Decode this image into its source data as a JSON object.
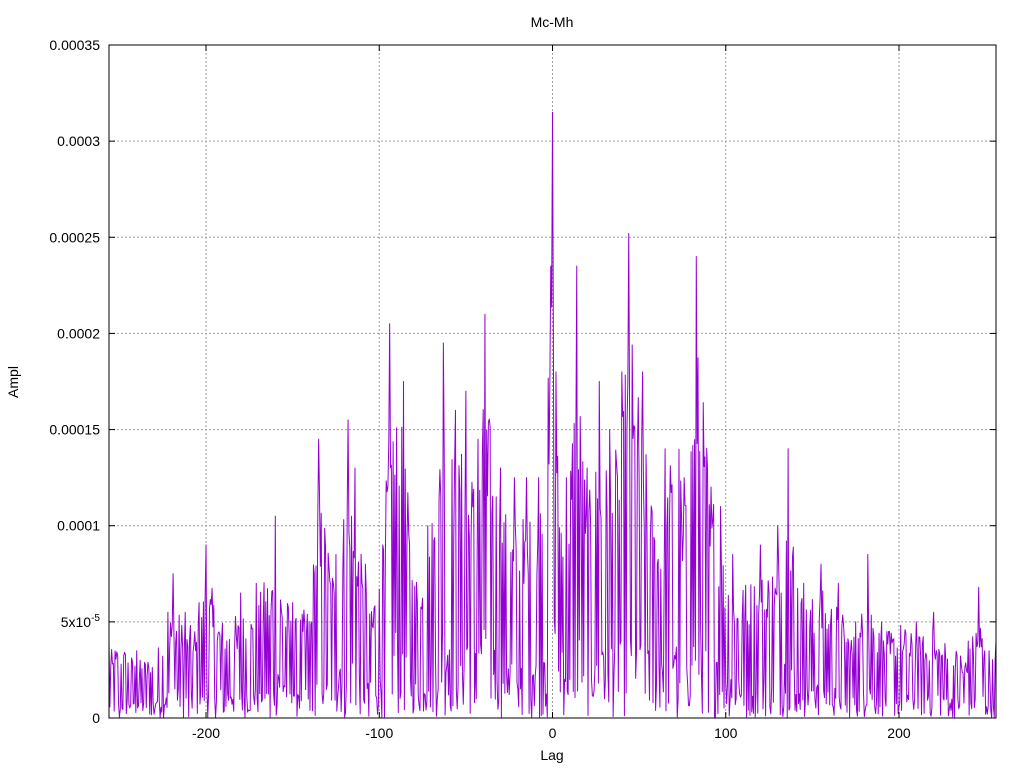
{
  "chart_data": {
    "type": "line",
    "title": "Mc-Mh",
    "xlabel": "Lag",
    "ylabel": "Ampl",
    "xlim": [
      -256,
      256
    ],
    "ylim": [
      0,
      0.00035
    ],
    "grid": true,
    "line_color": "#9400d3",
    "x_ticks": [
      {
        "value": -200,
        "label": "-200"
      },
      {
        "value": -100,
        "label": "-100"
      },
      {
        "value": 0,
        "label": "0"
      },
      {
        "value": 100,
        "label": "100"
      },
      {
        "value": 200,
        "label": "200"
      }
    ],
    "y_ticks": [
      {
        "value": 0,
        "label": "0"
      },
      {
        "value": 5e-05,
        "label": "5x10",
        "sup": "-5"
      },
      {
        "value": 0.0001,
        "label": "0.0001"
      },
      {
        "value": 0.00015,
        "label": "0.00015"
      },
      {
        "value": 0.0002,
        "label": "0.0002"
      },
      {
        "value": 0.00025,
        "label": "0.00025"
      },
      {
        "value": 0.0003,
        "label": "0.0003"
      },
      {
        "value": 0.00035,
        "label": "0.00035"
      }
    ],
    "peaks": [
      {
        "x": -256,
        "y": 4e-05
      },
      {
        "x": -250,
        "y": 4.8e-05
      },
      {
        "x": -240,
        "y": 3.5e-05
      },
      {
        "x": -230,
        "y": 4e-05
      },
      {
        "x": -222,
        "y": 5.5e-05
      },
      {
        "x": -219,
        "y": 7.5e-05
      },
      {
        "x": -212,
        "y": 5.5e-05
      },
      {
        "x": -204,
        "y": 6e-05
      },
      {
        "x": -200,
        "y": 9e-05
      },
      {
        "x": -190,
        "y": 6e-05
      },
      {
        "x": -180,
        "y": 6.5e-05
      },
      {
        "x": -171,
        "y": 7e-05
      },
      {
        "x": -160,
        "y": 0.000105
      },
      {
        "x": -150,
        "y": 6e-05
      },
      {
        "x": -140,
        "y": 7e-05
      },
      {
        "x": -135,
        "y": 0.000145
      },
      {
        "x": -125,
        "y": 8.5e-05
      },
      {
        "x": -118,
        "y": 0.000155
      },
      {
        "x": -114,
        "y": 0.00013
      },
      {
        "x": -108,
        "y": 8e-05
      },
      {
        "x": -98,
        "y": 9e-05
      },
      {
        "x": -94,
        "y": 0.000205
      },
      {
        "x": -86,
        "y": 0.000175
      },
      {
        "x": -80,
        "y": 9e-05
      },
      {
        "x": -72,
        "y": 0.0001
      },
      {
        "x": -63,
        "y": 0.000195
      },
      {
        "x": -56,
        "y": 0.00016
      },
      {
        "x": -50,
        "y": 0.00017
      },
      {
        "x": -43,
        "y": 0.000145
      },
      {
        "x": -39,
        "y": 0.00021
      },
      {
        "x": -30,
        "y": 0.00013
      },
      {
        "x": -22,
        "y": 0.000125
      },
      {
        "x": -15,
        "y": 0.000125
      },
      {
        "x": -8,
        "y": 0.000125
      },
      {
        "x": -1,
        "y": 0.000235
      },
      {
        "x": 0,
        "y": 0.000315
      },
      {
        "x": 2,
        "y": 0.00018
      },
      {
        "x": 8,
        "y": 0.000125
      },
      {
        "x": 14,
        "y": 0.000235
      },
      {
        "x": 20,
        "y": 0.00013
      },
      {
        "x": 27,
        "y": 0.000175
      },
      {
        "x": 33,
        "y": 0.00015
      },
      {
        "x": 40,
        "y": 0.00018
      },
      {
        "x": 44,
        "y": 0.000252
      },
      {
        "x": 52,
        "y": 0.00018
      },
      {
        "x": 58,
        "y": 0.00013
      },
      {
        "x": 65,
        "y": 0.00014
      },
      {
        "x": 72,
        "y": 0.00019
      },
      {
        "x": 76,
        "y": 0.000125
      },
      {
        "x": 83,
        "y": 0.00024
      },
      {
        "x": 90,
        "y": 0.000165
      },
      {
        "x": 97,
        "y": 0.00011
      },
      {
        "x": 104,
        "y": 8.5e-05
      },
      {
        "x": 112,
        "y": 8.5e-05
      },
      {
        "x": 120,
        "y": 9e-05
      },
      {
        "x": 130,
        "y": 0.0001
      },
      {
        "x": 136,
        "y": 0.00014
      },
      {
        "x": 145,
        "y": 7e-05
      },
      {
        "x": 155,
        "y": 8e-05
      },
      {
        "x": 165,
        "y": 7e-05
      },
      {
        "x": 175,
        "y": 5e-05
      },
      {
        "x": 182,
        "y": 8.5e-05
      },
      {
        "x": 190,
        "y": 5e-05
      },
      {
        "x": 200,
        "y": 6e-05
      },
      {
        "x": 210,
        "y": 5e-05
      },
      {
        "x": 220,
        "y": 5.5e-05
      },
      {
        "x": 230,
        "y": 4.5e-05
      },
      {
        "x": 240,
        "y": 4e-05
      },
      {
        "x": 246,
        "y": 6.8e-05
      },
      {
        "x": 252,
        "y": 3.5e-05
      },
      {
        "x": 256,
        "y": 4e-05
      }
    ],
    "troughs": [
      {
        "x": -250,
        "y": 5e-07
      },
      {
        "x": -230,
        "y": 2e-06
      },
      {
        "x": -210,
        "y": 8e-07
      },
      {
        "x": -190,
        "y": 3e-06
      },
      {
        "x": -163,
        "y": 5e-07
      },
      {
        "x": -140,
        "y": 4e-06
      },
      {
        "x": -120,
        "y": 5e-07
      },
      {
        "x": -106,
        "y": 1e-06
      },
      {
        "x": -97,
        "y": 5e-07
      },
      {
        "x": -80,
        "y": 5e-06
      },
      {
        "x": -60,
        "y": 1.2e-05
      },
      {
        "x": -45,
        "y": 8e-06
      },
      {
        "x": -20,
        "y": 1.5e-05
      },
      {
        "x": -3,
        "y": 5e-07
      },
      {
        "x": 10,
        "y": 2e-05
      },
      {
        "x": 30,
        "y": 1e-05
      },
      {
        "x": 58,
        "y": 8e-06
      },
      {
        "x": 72,
        "y": 5e-07
      },
      {
        "x": 90,
        "y": 3e-06
      },
      {
        "x": 112,
        "y": 5e-07
      },
      {
        "x": 140,
        "y": 4e-06
      },
      {
        "x": 170,
        "y": 3e-06
      },
      {
        "x": 200,
        "y": 6e-06
      },
      {
        "x": 230,
        "y": 4e-06
      },
      {
        "x": 250,
        "y": 2e-06
      }
    ]
  }
}
